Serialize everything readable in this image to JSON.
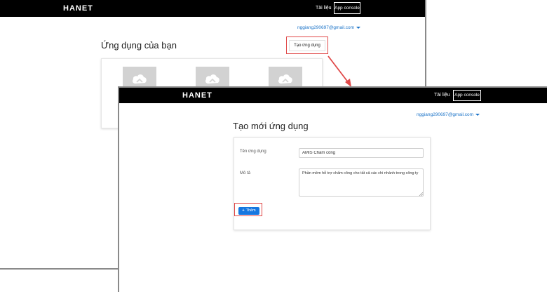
{
  "back_window": {
    "logo": "HANET",
    "nav": {
      "docs_link": "Tài liệu",
      "console_button": "App console"
    },
    "account_email": "nggiang290697@gmail.com",
    "page_title": "Ứng dụng của bạn",
    "create_app_button": "Tạo ứng dụng",
    "app_tiles": [
      {
        "icon": "cloud-app-icon"
      },
      {
        "icon": "cloud-app-icon"
      },
      {
        "icon": "cloud-app-icon"
      }
    ]
  },
  "front_window": {
    "logo": "HANET",
    "nav": {
      "docs_link": "Tài liệu",
      "console_button": "App console"
    },
    "account_email": "nggiang290697@gmail.com",
    "page_title": "Tạo mới ứng dụng",
    "form": {
      "name_label": "Tên ứng dụng",
      "name_value": "AMIS Chấm công",
      "description_label": "Mô tả",
      "description_value": "Phần mềm hỗ trợ chấm công cho tất cả các chi nhánh trong công ty",
      "add_button": "Thêm",
      "add_icon": "plus-icon"
    }
  },
  "colors": {
    "navbar": "#000000",
    "link": "#1a73c8",
    "primary_button": "#1677e0",
    "highlight": "#e04848"
  }
}
